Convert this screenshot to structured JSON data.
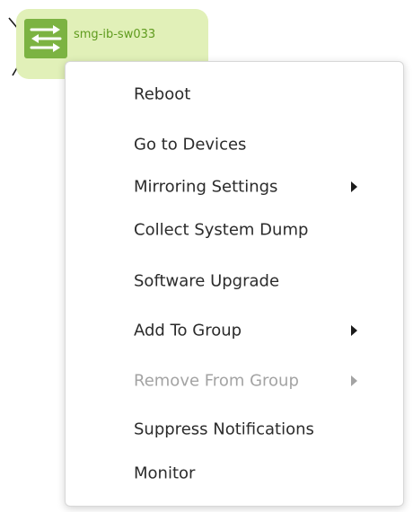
{
  "node": {
    "label": "smg-ib-sw033",
    "icon": "switch-arrows-icon",
    "card_color": "#e1f0b8",
    "icon_color": "#7cb342",
    "label_color": "#5f9b1e"
  },
  "context_menu": {
    "items": [
      {
        "label": "Reboot",
        "has_submenu": false,
        "enabled": true
      },
      {
        "label": "Go to Devices",
        "has_submenu": false,
        "enabled": true
      },
      {
        "label": "Mirroring Settings",
        "has_submenu": true,
        "enabled": true
      },
      {
        "label": "Collect System Dump",
        "has_submenu": false,
        "enabled": true
      },
      {
        "label": "Software Upgrade",
        "has_submenu": false,
        "enabled": true
      },
      {
        "label": "Add To Group",
        "has_submenu": true,
        "enabled": true
      },
      {
        "label": "Remove From Group",
        "has_submenu": true,
        "enabled": false
      },
      {
        "label": "Suppress Notifications",
        "has_submenu": false,
        "enabled": true
      },
      {
        "label": "Monitor",
        "has_submenu": false,
        "enabled": true
      }
    ]
  }
}
